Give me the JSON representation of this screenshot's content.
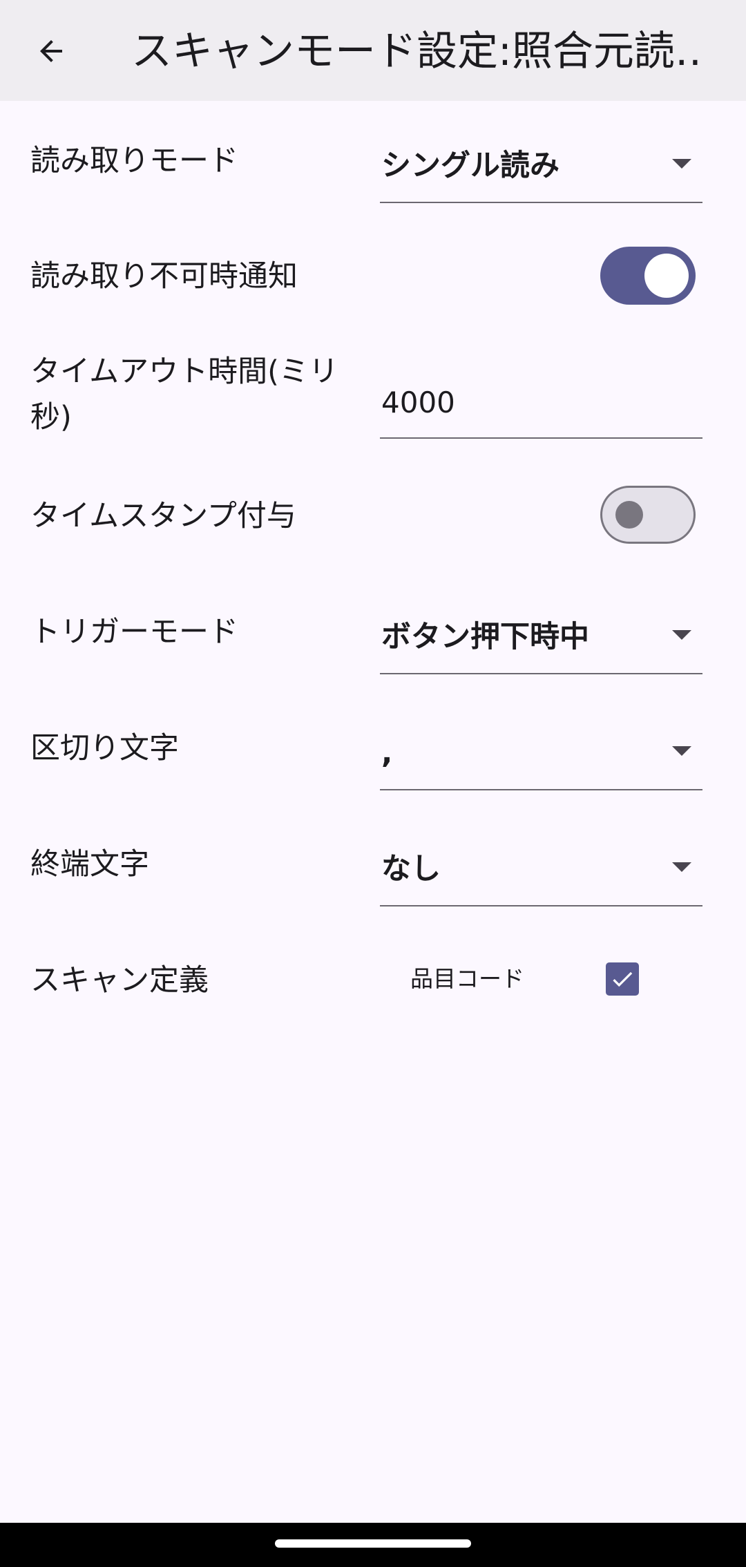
{
  "appbar": {
    "title": "スキャンモード設定:照合元読…"
  },
  "settings": {
    "read_mode": {
      "label": "読み取りモード",
      "value": "シングル読み"
    },
    "unreadable_notify": {
      "label": "読み取り不可時通知",
      "enabled": true
    },
    "timeout": {
      "label_line1": "タイムアウト時間(ミリ",
      "label_line2": "秒)",
      "value": "4000"
    },
    "timestamp": {
      "label": "タイムスタンプ付与",
      "enabled": false
    },
    "trigger_mode": {
      "label": "トリガーモード",
      "value": "ボタン押下時中"
    },
    "delimiter": {
      "label": "区切り文字",
      "value": ","
    },
    "terminator": {
      "label": "終端文字",
      "value": "なし"
    },
    "scan_definition": {
      "label": "スキャン定義",
      "item_label": "品目コード",
      "checked": true
    }
  },
  "colors": {
    "accent": "#585a91",
    "background": "#fcf8ff",
    "appbar": "#efedf1"
  },
  "icons": {
    "back": "arrow-left-icon",
    "dropdown": "triangle-down-icon",
    "check": "check-icon"
  }
}
